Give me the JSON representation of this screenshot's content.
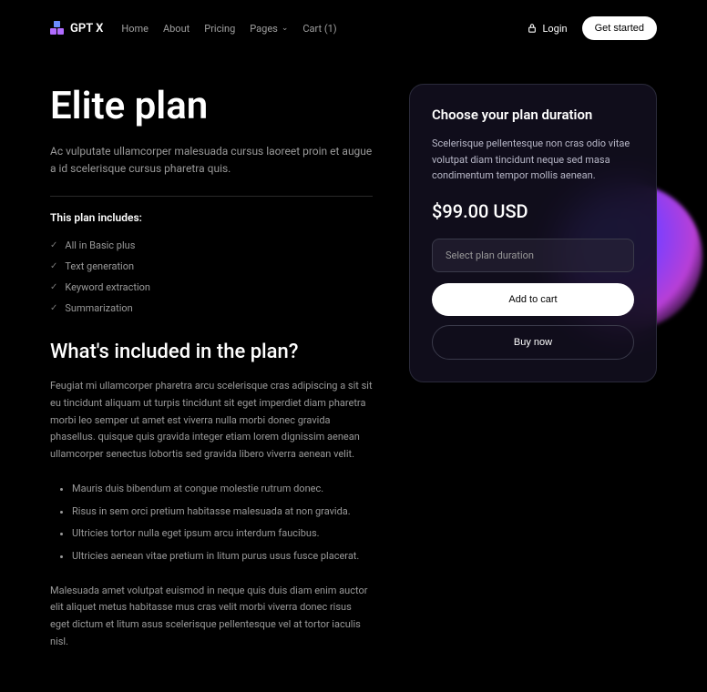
{
  "header": {
    "logo": "GPT X",
    "nav": {
      "home": "Home",
      "about": "About",
      "pricing": "Pricing",
      "pages": "Pages",
      "cart": "Cart (1)"
    },
    "login": "Login",
    "get_started": "Get started"
  },
  "plan": {
    "title": "Elite plan",
    "subtitle": "Ac vulputate ullamcorper malesuada cursus laoreet proin et augue a id scelerisque cursus pharetra quis.",
    "includes_title": "This plan includes:",
    "features": [
      "All in Basic plus",
      "Text generation",
      "Keyword extraction",
      "Summarization"
    ],
    "included_heading": "What's included in the plan?",
    "included_body1": "Feugiat mi ullamcorper pharetra arcu scelerisque cras adipiscing a sit sit eu tincidunt aliquam ut turpis tincidunt sit eget imperdiet diam pharetra morbi leo semper ut amet est viverra nulla morbi donec gravida phasellus. quisque quis gravida integer etiam lorem dignissim aenean ullamcorper senectus lobortis sed gravida libero viverra aenean velit.",
    "bullets": [
      "Mauris duis bibendum at congue molestie rutrum donec.",
      "Risus in sem orci pretium habitasse malesuada at non gravida.",
      "Ultricies tortor nulla eget ipsum arcu interdum faucibus.",
      "Ultricies aenean vitae pretium in litum purus usus fusce placerat."
    ],
    "included_body2": "Malesuada amet volutpat euismod in neque quis duis diam enim auctor elit aliquet metus habitasse mus cras velit morbi viverra donec risus eget dictum et litum asus scelerisque pellentesque vel at tortor iaculis nisl."
  },
  "card": {
    "title": "Choose your plan duration",
    "description": "Scelerisque pellentesque non cras odio vitae volutpat diam tincidunt neque sed masa condimentum tempor mollis aenean.",
    "price": "$99.00 USD",
    "select_placeholder": "Select plan duration",
    "add_to_cart": "Add to cart",
    "buy_now": "Buy now"
  }
}
